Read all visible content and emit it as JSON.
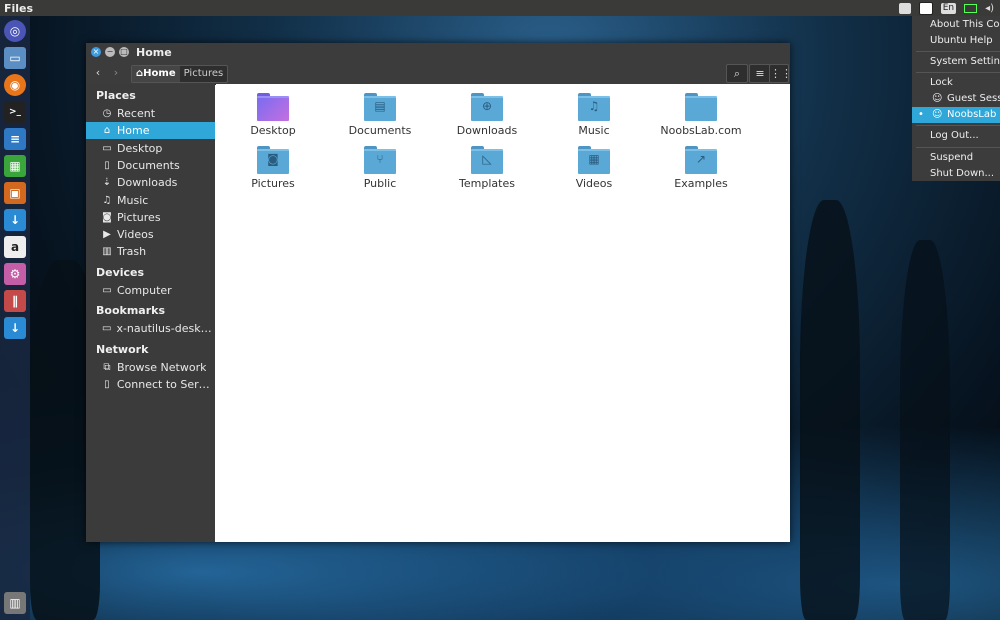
{
  "top_panel": {
    "app_title": "Files",
    "lang": "En"
  },
  "window": {
    "title": "Home",
    "breadcrumbs": [
      "Home",
      "Pictures"
    ],
    "icons": {
      "close": "×",
      "minimize": "−",
      "maximize": "□"
    }
  },
  "sidebar": {
    "places_header": "Places",
    "places": [
      {
        "label": "Recent",
        "icon": "◷"
      },
      {
        "label": "Home",
        "icon": "⌂"
      },
      {
        "label": "Desktop",
        "icon": "▭"
      },
      {
        "label": "Documents",
        "icon": "▯"
      },
      {
        "label": "Downloads",
        "icon": "⇣"
      },
      {
        "label": "Music",
        "icon": "♫"
      },
      {
        "label": "Pictures",
        "icon": "◙"
      },
      {
        "label": "Videos",
        "icon": "▶"
      },
      {
        "label": "Trash",
        "icon": "▥"
      }
    ],
    "devices_header": "Devices",
    "devices": [
      {
        "label": "Computer",
        "icon": "▭"
      }
    ],
    "bookmarks_header": "Bookmarks",
    "bookmarks": [
      {
        "label": "x-nautilus-desktop...",
        "icon": "▭"
      }
    ],
    "network_header": "Network",
    "network": [
      {
        "label": "Browse Network",
        "icon": "⧉"
      },
      {
        "label": "Connect to Server",
        "icon": "▯"
      }
    ]
  },
  "files": [
    {
      "label": "Desktop",
      "glyph": ""
    },
    {
      "label": "Documents",
      "glyph": "▤"
    },
    {
      "label": "Downloads",
      "glyph": "⊕"
    },
    {
      "label": "Music",
      "glyph": "♫"
    },
    {
      "label": "NoobsLab.com",
      "glyph": ""
    },
    {
      "label": "Pictures",
      "glyph": "◙"
    },
    {
      "label": "Public",
      "glyph": "⑂"
    },
    {
      "label": "Templates",
      "glyph": "◺"
    },
    {
      "label": "Videos",
      "glyph": "▦"
    },
    {
      "label": "Examples",
      "glyph": "↗"
    }
  ],
  "session_menu": {
    "items": [
      "About This Computer",
      "Ubuntu Help",
      "System Settings...",
      "Lock",
      "Guest Session",
      "NoobsLab",
      "Log Out...",
      "Suspend",
      "Shut Down..."
    ]
  }
}
